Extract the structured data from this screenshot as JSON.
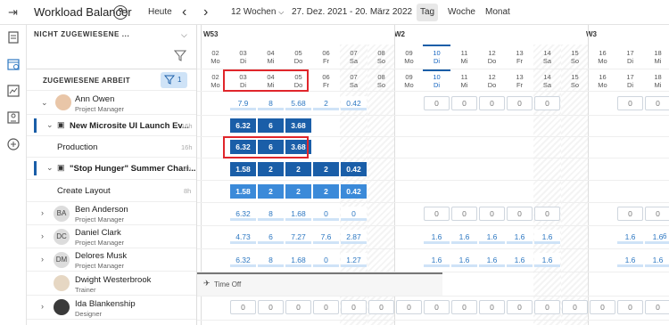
{
  "toolbar": {
    "title": "Workload Balancer",
    "help": "?",
    "today": "Heute",
    "prev": "‹",
    "next": "›",
    "range_select": "12 Wochen",
    "date_range": "27. Dez. 2021 - 20. März 2022",
    "views": [
      "Tag",
      "Woche",
      "Monat"
    ],
    "active_view": "Tag"
  },
  "left_panel": {
    "unassigned_header": "NICHT ZUGEWIESENE ...",
    "assigned_header": "ZUGEWIESENE ARBEIT",
    "filter_count": "1",
    "rows": [
      {
        "type": "user",
        "name": "Ann Owen",
        "role": "Project Manager",
        "expanded": true
      },
      {
        "type": "project",
        "name": "New Microsite UI Launch Ev...",
        "hours": "16h"
      },
      {
        "type": "task",
        "name": "Production",
        "hours": "16h"
      },
      {
        "type": "project",
        "name": "\"Stop Hunger\" Summer Chari...",
        "hours": "8h"
      },
      {
        "type": "task",
        "name": "Create Layout",
        "hours": "8h"
      },
      {
        "type": "user",
        "initials": "BA",
        "name": "Ben  Anderson",
        "role": "Project Manager"
      },
      {
        "type": "user",
        "initials": "DC",
        "name": "Daniel Clark",
        "role": "Project Manager"
      },
      {
        "type": "user",
        "initials": "DM",
        "name": "Delores Musk",
        "role": "Project Manager"
      },
      {
        "type": "user",
        "name": "Dwight Westerbrook",
        "role": "Trainer"
      },
      {
        "type": "user",
        "name": "Ida Blankenship",
        "role": "Designer"
      }
    ]
  },
  "weeks": [
    "W53",
    "W2",
    "W3"
  ],
  "days": [
    {
      "d": "02",
      "w": "Mo"
    },
    {
      "d": "03",
      "w": "Di"
    },
    {
      "d": "04",
      "w": "Mi"
    },
    {
      "d": "05",
      "w": "Do"
    },
    {
      "d": "06",
      "w": "Fr"
    },
    {
      "d": "07",
      "w": "Sa"
    },
    {
      "d": "08",
      "w": "So"
    },
    {
      "d": "09",
      "w": "Mo"
    },
    {
      "d": "10",
      "w": "Di"
    },
    {
      "d": "11",
      "w": "Mi"
    },
    {
      "d": "12",
      "w": "Do"
    },
    {
      "d": "13",
      "w": "Fr"
    },
    {
      "d": "14",
      "w": "Sa"
    },
    {
      "d": "15",
      "w": "So"
    },
    {
      "d": "16",
      "w": "Mo"
    },
    {
      "d": "17",
      "w": "Di"
    },
    {
      "d": "18",
      "w": "Mi"
    }
  ],
  "values": {
    "ann": [
      "7.9",
      "8",
      "5.68",
      "2",
      "0.42"
    ],
    "ann_zeros": [
      "0",
      "0",
      "0",
      "0",
      "0"
    ],
    "microsite": [
      "6.32",
      "6",
      "3.68"
    ],
    "production": [
      "6.32",
      "6",
      "3.68"
    ],
    "stop_hunger": [
      "1.58",
      "2",
      "2",
      "2",
      "0.42"
    ],
    "create_layout": [
      "1.58",
      "2",
      "2",
      "2",
      "0.42"
    ],
    "ben": [
      "6.32",
      "8",
      "1.68",
      "0",
      "0"
    ],
    "ben_zeros": [
      "0",
      "0",
      "0",
      "0",
      "0"
    ],
    "daniel": [
      "4.73",
      "6",
      "7.27",
      "7.6",
      "2.87"
    ],
    "daniel_next": [
      "1.6",
      "1.6",
      "1.6",
      "1.6",
      "1.6"
    ],
    "delores": [
      "6.32",
      "8",
      "1.68",
      "0",
      "1.27"
    ],
    "delores_next": [
      "1.6",
      "1.6",
      "1.6",
      "1.6",
      "1.6"
    ],
    "w3_ben": [
      "0",
      "0"
    ],
    "w3_daniel": [
      "1.6",
      "1.6"
    ],
    "w3_delores": [
      "1.6",
      "1.6"
    ],
    "w3_ann": [
      "0",
      "0"
    ],
    "ida": [
      "0",
      "0",
      "0",
      "0",
      "0",
      "0",
      "0",
      "0",
      "0",
      "0",
      "0",
      "0",
      "0",
      "0",
      "0",
      "0"
    ],
    "edge": "6"
  },
  "time_off_label": "Time Off"
}
